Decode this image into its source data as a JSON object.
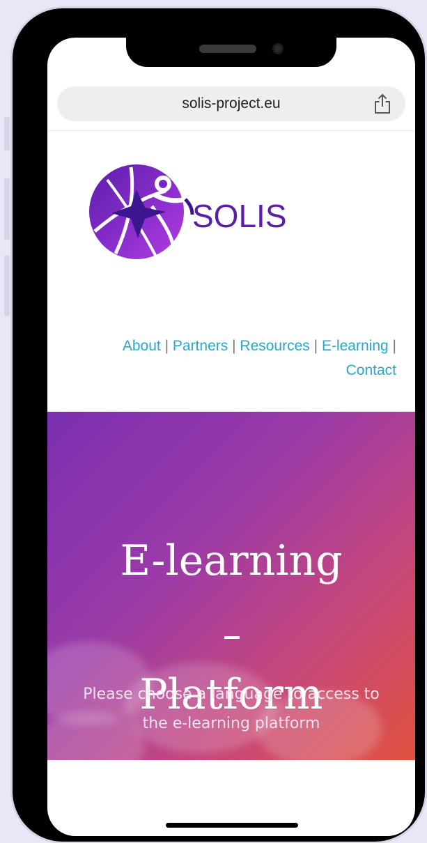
{
  "browser": {
    "url": "solis-project.eu",
    "share_icon": "share-icon"
  },
  "logo": {
    "text": "SOLIS",
    "colors": [
      "#6a1fb0",
      "#a82fd0",
      "#4a2a9a"
    ]
  },
  "nav": {
    "items": [
      {
        "label": "About"
      },
      {
        "label": "Partners"
      },
      {
        "label": "Resources"
      },
      {
        "label": "E-learning"
      },
      {
        "label": "Contact"
      }
    ],
    "separator": "|",
    "color": "#2aa6c9"
  },
  "hero": {
    "title_line1": "E-learning",
    "title_line2": "Platform",
    "dash": "–",
    "subtitle": "Please choose a language to access to the e-learning platform",
    "gradient_colors": [
      "#7b2fb0",
      "#c4467e",
      "#e0523e"
    ]
  }
}
